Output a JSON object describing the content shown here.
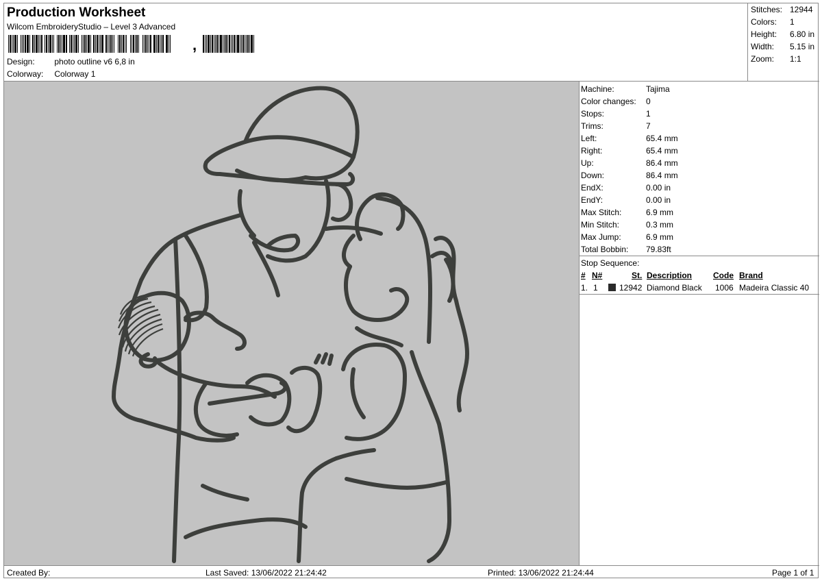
{
  "header": {
    "title": "Production Worksheet",
    "subtitle": "Wilcom EmbroideryStudio – Level 3 Advanced",
    "design_label": "Design:",
    "design_value": "photo outline v6 6,8 in",
    "colorway_label": "Colorway:",
    "colorway_value": "Colorway 1"
  },
  "stats": [
    {
      "label": "Stitches:",
      "value": "12944"
    },
    {
      "label": "Colors:",
      "value": "1"
    },
    {
      "label": "Height:",
      "value": "6.80 in"
    },
    {
      "label": "Width:",
      "value": "5.15 in"
    },
    {
      "label": "Zoom:",
      "value": "1:1"
    }
  ],
  "machine_info": [
    {
      "label": "Machine:",
      "value": "Tajima"
    },
    {
      "label": "Color changes:",
      "value": "0"
    },
    {
      "label": "Stops:",
      "value": "1"
    },
    {
      "label": "Trims:",
      "value": "7"
    },
    {
      "label": "Left:",
      "value": "65.4 mm"
    },
    {
      "label": "Right:",
      "value": "65.4 mm"
    },
    {
      "label": "Up:",
      "value": "86.4 mm"
    },
    {
      "label": "Down:",
      "value": "86.4 mm"
    },
    {
      "label": "EndX:",
      "value": "0.00 in"
    },
    {
      "label": "EndY:",
      "value": "0.00 in"
    },
    {
      "label": "Max Stitch:",
      "value": "6.9 mm"
    },
    {
      "label": "Min Stitch:",
      "value": "0.3 mm"
    },
    {
      "label": "Max Jump:",
      "value": "6.9 mm"
    },
    {
      "label": "Total Bobbin:",
      "value": "79.83ft"
    }
  ],
  "stop_sequence": {
    "title": "Stop Sequence:",
    "headers": {
      "num": "#",
      "n": "N#",
      "st": "St.",
      "description": "Description",
      "code": "Code",
      "brand": "Brand"
    },
    "rows": [
      {
        "num": "1.",
        "n": "1",
        "st": "12942",
        "description": "Diamond Black",
        "code": "1006",
        "brand": "Madeira Classic 40",
        "color": "#2a2a2a"
      }
    ]
  },
  "footer": {
    "created_by": "Created By:",
    "last_saved": "Last Saved: 13/06/2022 21:24:42",
    "printed": "Printed: 13/06/2022 21:24:44",
    "page": "Page 1 of 1"
  },
  "design_colors": {
    "background": "#c3c3c3",
    "thread": "#3d3f3c"
  }
}
